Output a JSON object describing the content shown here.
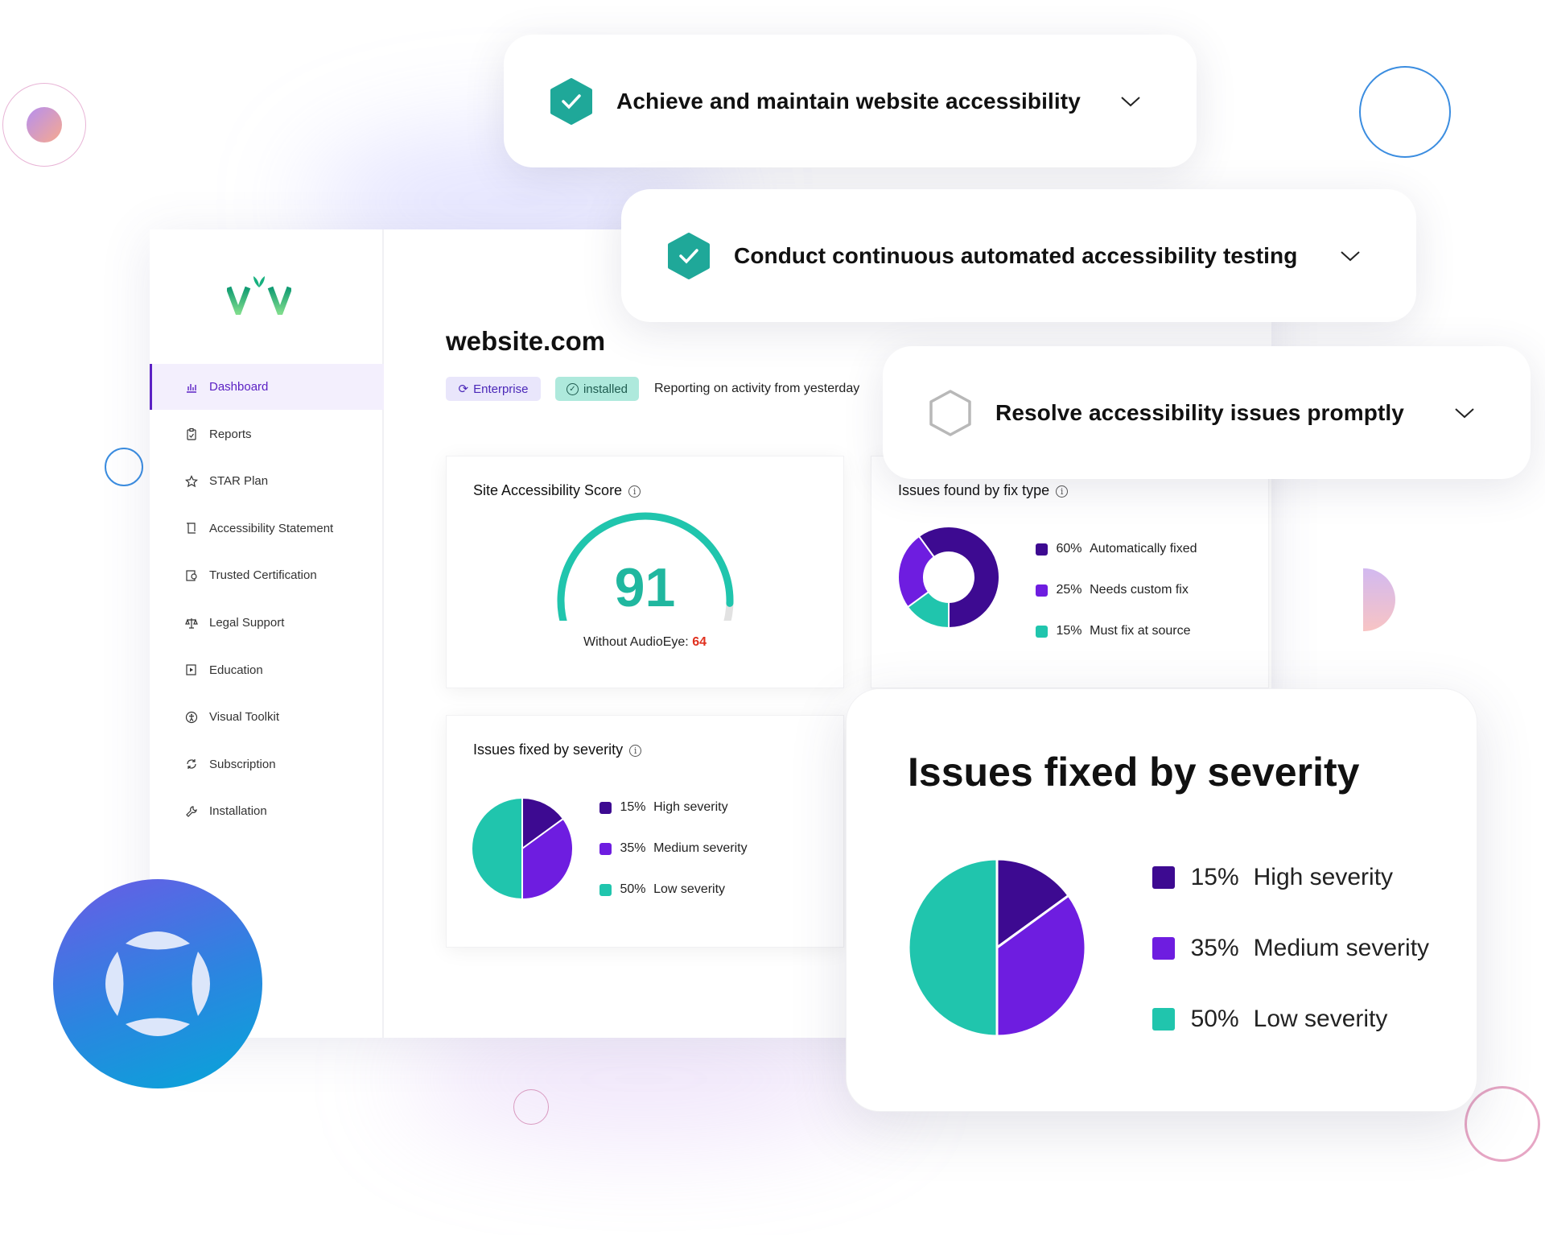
{
  "sidebar": {
    "logo": "viv",
    "items": [
      {
        "label": "Dashboard",
        "icon": "bar-chart-icon",
        "active": true
      },
      {
        "label": "Reports",
        "icon": "clipboard-icon"
      },
      {
        "label": "STAR Plan",
        "icon": "star-icon"
      },
      {
        "label": "Accessibility Statement",
        "icon": "scroll-icon"
      },
      {
        "label": "Trusted Certification",
        "icon": "certificate-icon"
      },
      {
        "label": "Legal Support",
        "icon": "scales-icon"
      },
      {
        "label": "Education",
        "icon": "play-book-icon"
      },
      {
        "label": "Visual Toolkit",
        "icon": "accessibility-icon"
      },
      {
        "label": "Subscription",
        "icon": "refresh-icon"
      },
      {
        "label": "Installation",
        "icon": "wrench-icon"
      }
    ]
  },
  "header": {
    "site": "website.com",
    "plan_badge": "Enterprise",
    "status_badge": "installed",
    "reporting": "Reporting on activity from yesterday"
  },
  "score_card": {
    "title": "Site Accessibility Score",
    "score": 91,
    "score_text": "91",
    "without_label": "Without AudioEye:",
    "without_value": "64"
  },
  "goals": [
    {
      "label": "Achieve and maintain website accessibility",
      "done": true
    },
    {
      "label": "Conduct continuous automated accessibility testing",
      "done": true
    },
    {
      "label": "Resolve accessibility issues promptly",
      "done": false
    }
  ],
  "colors": {
    "dark_purple": "#3d0a91",
    "purple": "#6e1de0",
    "teal": "#20c5ad",
    "accent": "#5b21c4",
    "red": "#e0301e",
    "gray": "#dcdcdc"
  },
  "chart_data": [
    {
      "type": "pie",
      "title": "Issues found by fix type",
      "donut": true,
      "slices": [
        {
          "pct": "60%",
          "label": "Automatically fixed",
          "value": 60,
          "color": "#3d0a91"
        },
        {
          "pct": "25%",
          "label": "Needs custom fix",
          "value": 25,
          "color": "#6e1de0"
        },
        {
          "pct": "15%",
          "label": "Must fix at source",
          "value": 15,
          "color": "#20c5ad"
        }
      ]
    },
    {
      "type": "pie",
      "title": "Issues fixed by severity",
      "slices": [
        {
          "pct": "15%",
          "label": "High severity",
          "value": 15,
          "color": "#3d0a91"
        },
        {
          "pct": "35%",
          "label": "Medium severity",
          "value": 35,
          "color": "#6e1de0"
        },
        {
          "pct": "50%",
          "label": "Low severity",
          "value": 50,
          "color": "#20c5ad"
        }
      ]
    }
  ]
}
